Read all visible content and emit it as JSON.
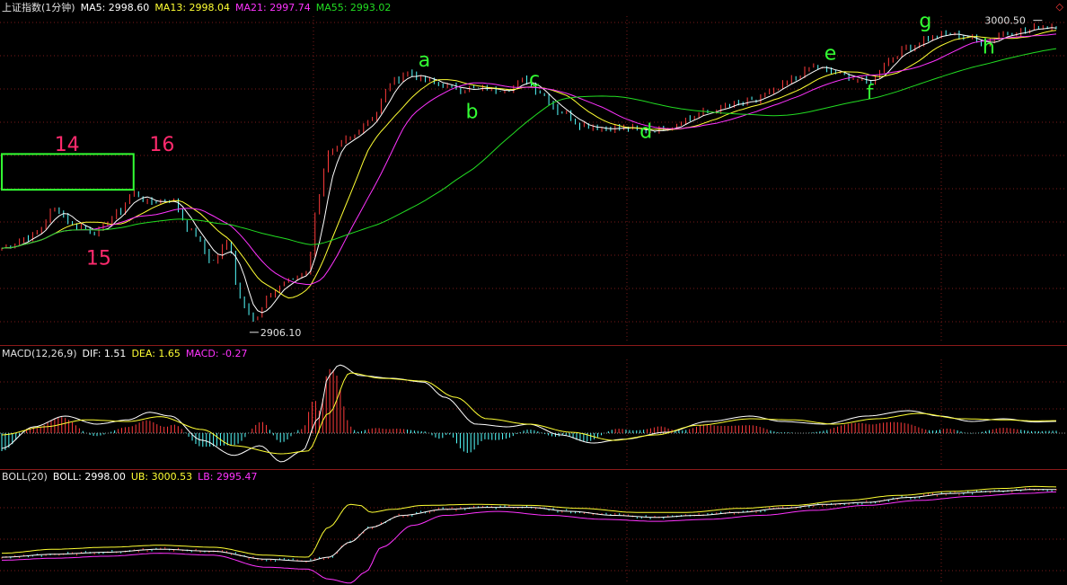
{
  "colors": {
    "background": "#000000",
    "grid": "#7a1a1a",
    "up": "#ff3b3b",
    "down": "#54ffff",
    "white": "#ffffff",
    "yellow": "#ffff33",
    "magenta": "#ff33ff",
    "green": "#22dd22",
    "annot_pink": "#ff2a6d",
    "annot_green": "#33ff33"
  },
  "price_panel": {
    "title": "上证指数(1分钟)",
    "ma": [
      {
        "label": "MA5: 2998.60",
        "color": "#ffffff"
      },
      {
        "label": "MA13: 2998.04",
        "color": "#ffff33"
      },
      {
        "label": "MA21: 2997.74",
        "color": "#ff33ff"
      },
      {
        "label": "MA55: 2993.02",
        "color": "#22dd22"
      }
    ],
    "high_label": "3000.50",
    "low_label": "2906.10",
    "corner_icon": "diamond-icon"
  },
  "macd_panel": {
    "title": "MACD(12,26,9)",
    "items": [
      {
        "label": "DIF: 1.51",
        "color": "#ffffff"
      },
      {
        "label": "DEA: 1.65",
        "color": "#ffff33"
      },
      {
        "label": "MACD: -0.27",
        "color": "#ff33ff"
      }
    ]
  },
  "boll_panel": {
    "title": "BOLL(20)",
    "items": [
      {
        "label": "BOLL: 2998.00",
        "color": "#ffffff"
      },
      {
        "label": "UB: 3000.53",
        "color": "#ffff33"
      },
      {
        "label": "LB: 2995.47",
        "color": "#ff33ff"
      }
    ]
  },
  "annotations": [
    {
      "text": "14",
      "color": "#ff2a6d",
      "t": 0.05,
      "v": 2962
    },
    {
      "text": "16",
      "color": "#ff2a6d",
      "t": 0.14,
      "v": 2962
    },
    {
      "text": "15",
      "color": "#ff2a6d",
      "t": 0.08,
      "v": 2927
    },
    {
      "text": "a",
      "color": "#33ff33",
      "t": 0.395,
      "v": 2988
    },
    {
      "text": "b",
      "color": "#33ff33",
      "t": 0.44,
      "v": 2972
    },
    {
      "text": "c",
      "color": "#33ff33",
      "t": 0.5,
      "v": 2982
    },
    {
      "text": "d",
      "color": "#33ff33",
      "t": 0.605,
      "v": 2966
    },
    {
      "text": "e",
      "color": "#33ff33",
      "t": 0.78,
      "v": 2990
    },
    {
      "text": "f",
      "color": "#33ff33",
      "t": 0.82,
      "v": 2978
    },
    {
      "text": "g",
      "color": "#33ff33",
      "t": 0.87,
      "v": 3000
    },
    {
      "text": "h",
      "color": "#33ff33",
      "t": 0.93,
      "v": 2992
    }
  ],
  "chart_data": [
    {
      "type": "line",
      "name": "上证指数(1分钟)",
      "ylim": [
        2903,
        3004
      ],
      "high": 3000.5,
      "low": 2906.1,
      "price_path": [
        [
          0.0,
          2932
        ],
        [
          0.03,
          2936
        ],
        [
          0.05,
          2944
        ],
        [
          0.07,
          2939
        ],
        [
          0.09,
          2937
        ],
        [
          0.11,
          2943
        ],
        [
          0.125,
          2949
        ],
        [
          0.14,
          2946
        ],
        [
          0.16,
          2947
        ],
        [
          0.18,
          2937
        ],
        [
          0.2,
          2928
        ],
        [
          0.215,
          2934
        ],
        [
          0.225,
          2917
        ],
        [
          0.24,
          2910
        ],
        [
          0.255,
          2918
        ],
        [
          0.27,
          2922
        ],
        [
          0.29,
          2925
        ],
        [
          0.3,
          2948
        ],
        [
          0.31,
          2961
        ],
        [
          0.33,
          2966
        ],
        [
          0.35,
          2972
        ],
        [
          0.37,
          2983
        ],
        [
          0.385,
          2986
        ],
        [
          0.4,
          2984
        ],
        [
          0.42,
          2982
        ],
        [
          0.44,
          2981
        ],
        [
          0.46,
          2981
        ],
        [
          0.48,
          2981
        ],
        [
          0.495,
          2984
        ],
        [
          0.51,
          2980
        ],
        [
          0.53,
          2974
        ],
        [
          0.55,
          2970
        ],
        [
          0.57,
          2969
        ],
        [
          0.59,
          2969
        ],
        [
          0.61,
          2968
        ],
        [
          0.63,
          2969
        ],
        [
          0.65,
          2972
        ],
        [
          0.67,
          2974
        ],
        [
          0.69,
          2976
        ],
        [
          0.71,
          2977
        ],
        [
          0.73,
          2980
        ],
        [
          0.75,
          2984
        ],
        [
          0.77,
          2988
        ],
        [
          0.79,
          2986
        ],
        [
          0.81,
          2984
        ],
        [
          0.825,
          2983
        ],
        [
          0.84,
          2990
        ],
        [
          0.86,
          2994
        ],
        [
          0.88,
          2997
        ],
        [
          0.9,
          2998
        ],
        [
          0.915,
          2997
        ],
        [
          0.93,
          2995
        ],
        [
          0.95,
          2998
        ],
        [
          0.97,
          2999
        ],
        [
          0.985,
          3000
        ],
        [
          1.0,
          3000.5
        ]
      ],
      "low_at": 0.235,
      "high_at": 0.985,
      "series": [
        {
          "name": "MA5",
          "color": "#ffffff"
        },
        {
          "name": "MA13",
          "color": "#ffff33"
        },
        {
          "name": "MA21",
          "color": "#ff33ff"
        },
        {
          "name": "MA55",
          "color": "#22dd22"
        }
      ]
    },
    {
      "type": "bar",
      "name": "MACD(12,26,9)",
      "ylim": [
        -7,
        13
      ],
      "dif_path": [
        [
          0.0,
          -3.5
        ],
        [
          0.03,
          0.5
        ],
        [
          0.06,
          2.5
        ],
        [
          0.09,
          1
        ],
        [
          0.12,
          1.8
        ],
        [
          0.14,
          3.2
        ],
        [
          0.16,
          2.5
        ],
        [
          0.19,
          -2
        ],
        [
          0.22,
          -4.8
        ],
        [
          0.245,
          -3
        ],
        [
          0.265,
          -6
        ],
        [
          0.285,
          -4
        ],
        [
          0.3,
          2
        ],
        [
          0.31,
          10
        ],
        [
          0.32,
          12
        ],
        [
          0.34,
          10
        ],
        [
          0.37,
          9.5
        ],
        [
          0.4,
          8.8
        ],
        [
          0.42,
          6
        ],
        [
          0.45,
          1
        ],
        [
          0.48,
          0.5
        ],
        [
          0.5,
          1
        ],
        [
          0.53,
          -1
        ],
        [
          0.56,
          -2.5
        ],
        [
          0.59,
          -1.8
        ],
        [
          0.63,
          -0.5
        ],
        [
          0.67,
          1.5
        ],
        [
          0.71,
          2.5
        ],
        [
          0.74,
          1.5
        ],
        [
          0.78,
          1
        ],
        [
          0.82,
          2.5
        ],
        [
          0.86,
          3.5
        ],
        [
          0.89,
          2.5
        ],
        [
          0.92,
          1.5
        ],
        [
          0.95,
          2
        ],
        [
          0.98,
          1.4
        ],
        [
          1.0,
          1.51
        ]
      ],
      "dea_path": [
        [
          0.0,
          -1
        ],
        [
          0.04,
          0.5
        ],
        [
          0.08,
          1.8
        ],
        [
          0.12,
          1.5
        ],
        [
          0.15,
          2.4
        ],
        [
          0.19,
          0
        ],
        [
          0.22,
          -3
        ],
        [
          0.265,
          -4.5
        ],
        [
          0.29,
          -4
        ],
        [
          0.31,
          3
        ],
        [
          0.33,
          10.5
        ],
        [
          0.36,
          9.5
        ],
        [
          0.4,
          9
        ],
        [
          0.43,
          6
        ],
        [
          0.46,
          2
        ],
        [
          0.5,
          1
        ],
        [
          0.54,
          -0.5
        ],
        [
          0.58,
          -2
        ],
        [
          0.62,
          -1
        ],
        [
          0.66,
          0.8
        ],
        [
          0.71,
          2
        ],
        [
          0.75,
          1.8
        ],
        [
          0.79,
          1
        ],
        [
          0.83,
          2
        ],
        [
          0.87,
          3
        ],
        [
          0.91,
          2
        ],
        [
          0.95,
          1.8
        ],
        [
          0.98,
          1.6
        ],
        [
          1.0,
          1.65
        ]
      ]
    },
    {
      "type": "line",
      "name": "BOLL(20)",
      "ylim": [
        2903,
        3004
      ],
      "boll_path": [
        [
          0.0,
          2930
        ],
        [
          0.05,
          2933
        ],
        [
          0.1,
          2935
        ],
        [
          0.15,
          2938
        ],
        [
          0.2,
          2936
        ],
        [
          0.25,
          2928
        ],
        [
          0.29,
          2926
        ],
        [
          0.31,
          2930
        ],
        [
          0.33,
          2945
        ],
        [
          0.35,
          2960
        ],
        [
          0.38,
          2972
        ],
        [
          0.42,
          2978
        ],
        [
          0.46,
          2980
        ],
        [
          0.5,
          2980
        ],
        [
          0.54,
          2976
        ],
        [
          0.58,
          2972
        ],
        [
          0.62,
          2970
        ],
        [
          0.66,
          2972
        ],
        [
          0.7,
          2975
        ],
        [
          0.74,
          2979
        ],
        [
          0.78,
          2983
        ],
        [
          0.82,
          2985
        ],
        [
          0.86,
          2990
        ],
        [
          0.9,
          2994
        ],
        [
          0.94,
          2996
        ],
        [
          0.98,
          2998
        ],
        [
          1.0,
          2998
        ]
      ],
      "ub_path": [
        [
          0.0,
          2934
        ],
        [
          0.05,
          2938
        ],
        [
          0.1,
          2940
        ],
        [
          0.15,
          2942
        ],
        [
          0.2,
          2940
        ],
        [
          0.25,
          2932
        ],
        [
          0.29,
          2930
        ],
        [
          0.31,
          2960
        ],
        [
          0.33,
          2983
        ],
        [
          0.34,
          2982
        ],
        [
          0.35,
          2975
        ],
        [
          0.37,
          2978
        ],
        [
          0.4,
          2982
        ],
        [
          0.45,
          2983
        ],
        [
          0.5,
          2982
        ],
        [
          0.55,
          2979
        ],
        [
          0.6,
          2975
        ],
        [
          0.65,
          2975
        ],
        [
          0.7,
          2979
        ],
        [
          0.75,
          2982
        ],
        [
          0.8,
          2987
        ],
        [
          0.85,
          2992
        ],
        [
          0.9,
          2996
        ],
        [
          0.95,
          2999
        ],
        [
          0.98,
          3001
        ],
        [
          1.0,
          3000.5
        ]
      ],
      "lb_path": [
        [
          0.0,
          2927
        ],
        [
          0.05,
          2929
        ],
        [
          0.1,
          2931
        ],
        [
          0.15,
          2934
        ],
        [
          0.2,
          2932
        ],
        [
          0.25,
          2920
        ],
        [
          0.29,
          2918
        ],
        [
          0.31,
          2908
        ],
        [
          0.33,
          2904
        ],
        [
          0.345,
          2915
        ],
        [
          0.36,
          2940
        ],
        [
          0.39,
          2962
        ],
        [
          0.42,
          2972
        ],
        [
          0.47,
          2976
        ],
        [
          0.52,
          2972
        ],
        [
          0.57,
          2968
        ],
        [
          0.62,
          2966
        ],
        [
          0.67,
          2968
        ],
        [
          0.72,
          2972
        ],
        [
          0.77,
          2977
        ],
        [
          0.82,
          2982
        ],
        [
          0.87,
          2987
        ],
        [
          0.92,
          2991
        ],
        [
          0.97,
          2994
        ],
        [
          1.0,
          2995.5
        ]
      ]
    }
  ]
}
